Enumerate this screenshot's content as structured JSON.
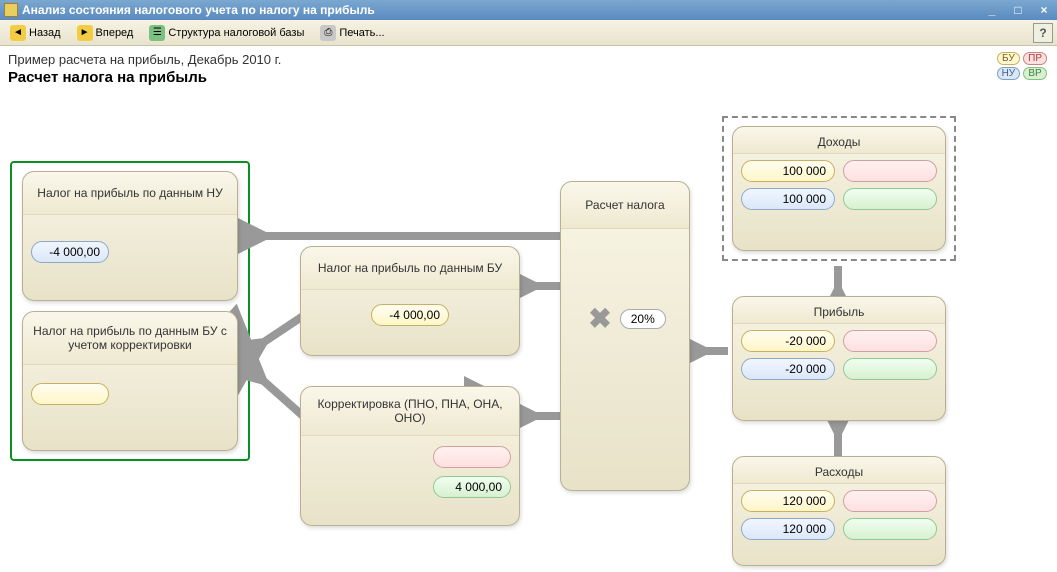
{
  "window": {
    "title": "Анализ состояния налогового учета по налогу на прибыль"
  },
  "toolbar": {
    "back": "Назад",
    "forward": "Вперед",
    "structure": "Структура налоговой базы",
    "print": "Печать..."
  },
  "header": {
    "subtitle": "Пример расчета на прибыль, Декабрь 2010 г.",
    "title": "Расчет налога на прибыль"
  },
  "legend": {
    "bu": "БУ",
    "pr": "ПР",
    "nu": "НУ",
    "vr": "ВР"
  },
  "nodes": {
    "tax_nu": {
      "title": "Налог на прибыль по данным НУ",
      "value": "-4 000,00"
    },
    "tax_bu_corr": {
      "title": "Налог на прибыль по данным БУ с учетом корректировки",
      "value": ""
    },
    "tax_bu": {
      "title": "Налог на прибыль по данным БУ",
      "value": "-4 000,00"
    },
    "correction": {
      "title": "Корректировка (ПНО, ПНА, ОНА, ОНО)",
      "pink": "",
      "green": "4 000,00"
    },
    "calc": {
      "title": "Расчет налога",
      "rate": "20%"
    },
    "income": {
      "title": "Доходы",
      "yellow": "100 000",
      "pink": "",
      "blue": "100 000",
      "green": ""
    },
    "profit": {
      "title": "Прибыль",
      "yellow": "-20 000",
      "pink": "",
      "blue": "-20 000",
      "green": ""
    },
    "expense": {
      "title": "Расходы",
      "yellow": "120 000",
      "pink": "",
      "blue": "120 000",
      "green": ""
    }
  }
}
